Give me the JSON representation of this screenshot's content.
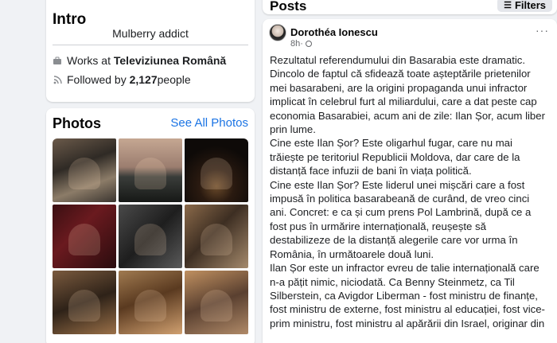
{
  "intro": {
    "title": "Intro",
    "bio": "Mulberry addict",
    "work_prefix": "Works at ",
    "work_place": "Televiziunea Română",
    "followed_prefix": "Followed by ",
    "followed_count": "2,127",
    "followed_suffix": " people",
    "icons": [
      "briefcase-icon",
      "rss-icon"
    ]
  },
  "photos": {
    "title": "Photos",
    "see_all": "See All Photos",
    "items": [
      "photo-1",
      "photo-2",
      "photo-3",
      "photo-4",
      "photo-5",
      "photo-6",
      "photo-7",
      "photo-8",
      "photo-9"
    ]
  },
  "posts": {
    "title": "Posts",
    "filters_label": "Filters",
    "filters_icon": "sliders-icon"
  },
  "post": {
    "author": "Dorothéa Ionescu",
    "time": "8h",
    "separator": " · ",
    "privacy_icon": "globe-icon",
    "more_icon": "more-dots-icon",
    "paragraphs": [
      "Rezultatul referendumului din Basarabia este dramatic. Dincolo de faptul că sfidează toate așteptările prietenilor mei basarabeni, are la origini propaganda unui infractor implicat în celebrul furt al miliardului, care a dat peste cap economia Basarabiei, acum ani de zile: Ilan Șor, acum liber prin lume.",
      "Cine este Ilan Șor? Este oligarhul fugar, care nu mai trăiește pe teritoriul Republicii Moldova, dar care de la distanță face infuzii de bani în viața politică.",
      "Cine este Ilan Șor? Este liderul unei mișcări care a fost impusă în politica basarabeană de curând, de vreo cinci ani. Concret: e ca și cum prens Pol Lambrină, după ce a fost pus în urmărire internațională, reușește să destabilizeze de la distanță alegerile care vor urma în România, în următoarele două luni.",
      "Ilan Șor este un infractor evreu de talie internațională care n-a pățit nimic, niciodată. Ca Benny Steinmetz, ca Til Silberstein, ca Avigdor Liberman - fost ministru de finanțe, fost ministru de externe, fost ministru al educației, fost vice-prim ministru, fost ministru al apărării din Israel, originar din"
    ]
  }
}
